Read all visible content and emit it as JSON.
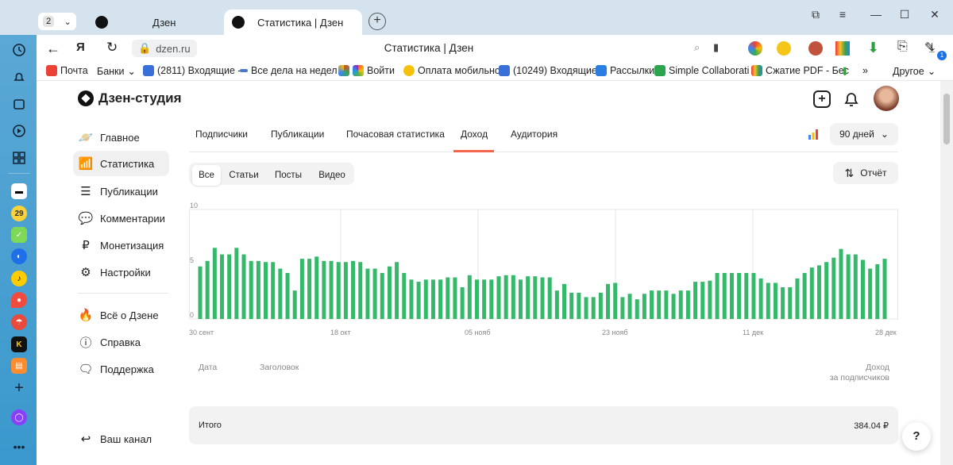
{
  "browser": {
    "tab_count": "2",
    "tabs": [
      {
        "label": "Дзен"
      },
      {
        "label": "Статистика | Дзен"
      }
    ],
    "address": "dzen.ru",
    "page_title": "Статистика | Дзен",
    "download_badge": "1",
    "bookmarks": [
      {
        "label": "Почта"
      },
      {
        "label": "Банки"
      },
      {
        "label": "(2811) Входящие -"
      },
      {
        "label": "Все дела на недел"
      },
      {
        "label": "Войти"
      },
      {
        "label": "Оплата мобильно"
      },
      {
        "label": "(10249) Входящие"
      },
      {
        "label": "Рассылки"
      },
      {
        "label": "Simple Collaborati"
      },
      {
        "label": "Сжатие PDF - Бес"
      },
      {
        "label": "Другое"
      }
    ]
  },
  "os_sidebar": {
    "badge": "29"
  },
  "studio": {
    "logo": "Дзен-студия",
    "nav": [
      {
        "label": "Главное",
        "icon": "planet-icon"
      },
      {
        "label": "Статистика",
        "icon": "bars-icon"
      },
      {
        "label": "Публикации",
        "icon": "stack-icon"
      },
      {
        "label": "Комментарии",
        "icon": "comment-icon"
      },
      {
        "label": "Монетизация",
        "icon": "ruble-icon"
      },
      {
        "label": "Настройки",
        "icon": "gear-icon"
      }
    ],
    "nav2": [
      {
        "label": "Всё о Дзене",
        "icon": "flame-icon"
      },
      {
        "label": "Справка",
        "icon": "question-icon"
      },
      {
        "label": "Поддержка",
        "icon": "chat-icon"
      }
    ],
    "back": "Ваш канал",
    "tabs": [
      "Подписчики",
      "Публикации",
      "Почасовая статистика",
      "Доход",
      "Аудитория"
    ],
    "active_tab": "Доход",
    "period": "90 дней",
    "filters": [
      "Все",
      "Статьи",
      "Посты",
      "Видео"
    ],
    "report": "Отчёт",
    "table": {
      "col_date": "Дата",
      "col_title": "Заголовок",
      "col_income_1": "Доход",
      "col_income_2": "за подписчиков",
      "total_label": "Итого",
      "total_value": "384.04 ₽"
    },
    "help": "?",
    "accent": "#f6644e",
    "bar_color": "#34b96a"
  },
  "chart_data": {
    "type": "bar",
    "ylim": [
      0,
      10
    ],
    "yticks": [
      "10",
      "5",
      "0"
    ],
    "xticks": [
      "30 сент",
      "18 окт",
      "05 нояб",
      "23 нояб",
      "11 дек",
      "28 дек"
    ],
    "series": [
      {
        "values": [
          4.8,
          5.3,
          6.5,
          5.9,
          5.9,
          6.5,
          5.9,
          5.3,
          5.3,
          5.2,
          5.2,
          4.6,
          4.2,
          2.6,
          5.5,
          5.5,
          5.7,
          5.3,
          5.3,
          5.2,
          5.2,
          5.3,
          5.2,
          4.6,
          4.6,
          4.2,
          4.8,
          5.2,
          4.2,
          3.6,
          3.4,
          3.6,
          3.6,
          3.6,
          3.8,
          3.8,
          2.9,
          4.0,
          3.6,
          3.6,
          3.6,
          3.9,
          4.0,
          4.0,
          3.6,
          3.9,
          3.9,
          3.8,
          3.8,
          2.6,
          3.2,
          2.4,
          2.4,
          2.0,
          2.0,
          2.4,
          3.2,
          3.3,
          2.0,
          2.3,
          1.8,
          2.3,
          2.6,
          2.6,
          2.6,
          2.3,
          2.6,
          2.6,
          3.4,
          3.4,
          3.5,
          4.2,
          4.2,
          4.2,
          4.2,
          4.2,
          4.2,
          3.7,
          3.3,
          3.3,
          2.9,
          2.9,
          3.7,
          4.2,
          4.7,
          4.9,
          5.2,
          5.6,
          6.4,
          5.9,
          5.9,
          5.4,
          4.6,
          5.0,
          5.5
        ]
      }
    ]
  }
}
